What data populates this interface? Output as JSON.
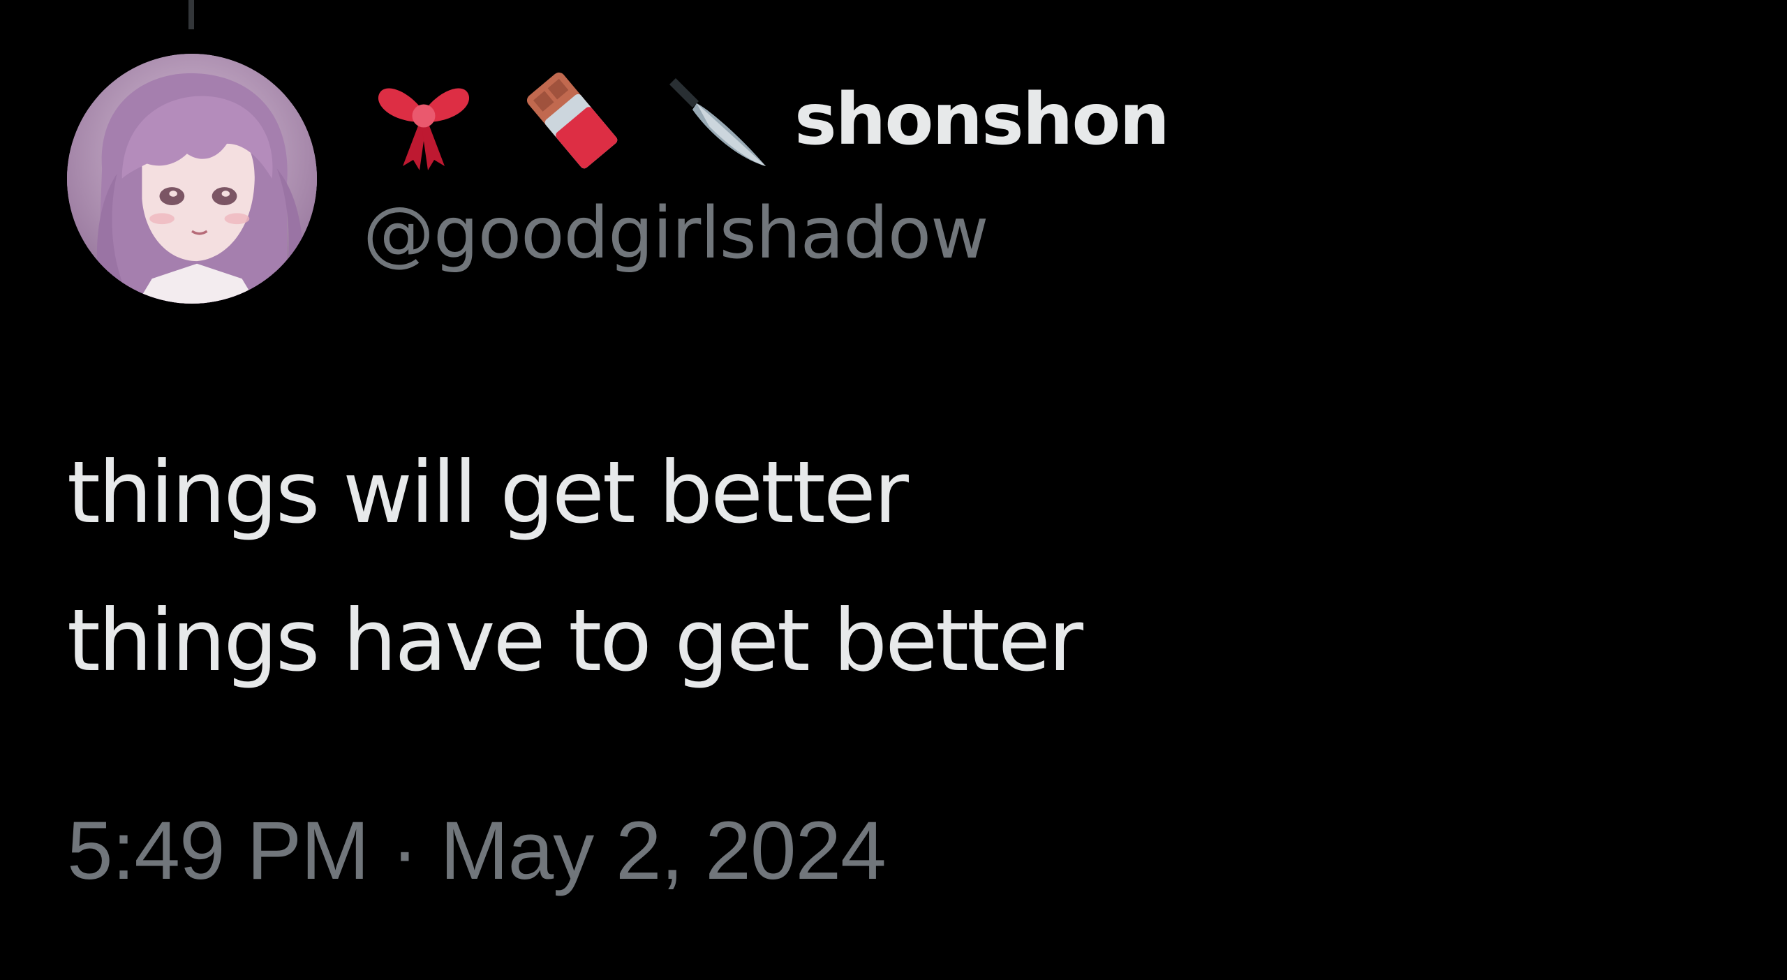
{
  "tweet": {
    "author": {
      "display_name_emojis": [
        "ribbon-emoji",
        "chocolate-bar-emoji",
        "kitchen-knife-emoji"
      ],
      "display_name": "shonshon",
      "handle": "@goodgirlshadow"
    },
    "text_lines": [
      "things will get better",
      "things have to get better"
    ],
    "time": "5:49 PM",
    "separator": " · ",
    "date": "May 2, 2024"
  },
  "colors": {
    "background": "#000000",
    "primary_text": "#e7e9ea",
    "secondary_text": "#71767b",
    "thread_line": "#333639"
  }
}
